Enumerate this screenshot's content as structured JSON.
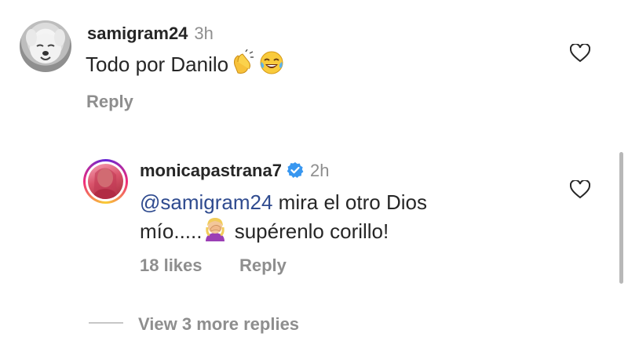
{
  "comment1": {
    "username": "samigram24",
    "time": "3h",
    "text": "Todo por Danilo",
    "emojis": [
      "clapping-hands-emoji",
      "tears-of-joy-emoji"
    ],
    "reply_label": "Reply"
  },
  "comment2": {
    "username": "monicapastrana7",
    "verified": true,
    "time": "2h",
    "mention": "@samigram24",
    "text_line1": " mira el otro Dios",
    "text_line2a": "mío.....",
    "text_line2b": " supérenlo corillo!",
    "emojis": [
      "woman-facepalming-emoji"
    ],
    "likes_label": "18 likes",
    "reply_label": "Reply"
  },
  "view_more_label": "View 3 more replies",
  "colors": {
    "text": "#262626",
    "secondary": "#8e8e8e",
    "mention": "#2f4b8f",
    "verified": "#3897f0"
  }
}
